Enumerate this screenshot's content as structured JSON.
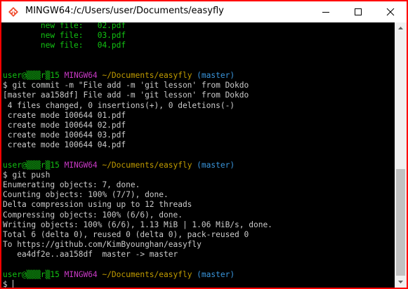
{
  "window": {
    "title": "MINGW64:/c/Users/user/Documents/easyfly",
    "icon": "mingw-icon"
  },
  "colors": {
    "green": "#13c313",
    "magenta": "#c839c5",
    "yellow": "#c19c00",
    "cyan": "#3a96dd",
    "text": "#cccccc"
  },
  "terminal": {
    "lines": [
      [
        {
          "t": "        new file:   02.pdf",
          "c": "green"
        }
      ],
      [
        {
          "t": "        new file:   03.pdf",
          "c": "green"
        }
      ],
      [
        {
          "t": "        new file:   04.pdf",
          "c": "green"
        }
      ],
      [
        {
          "t": "",
          "c": "text"
        }
      ],
      [
        {
          "t": "",
          "c": "text"
        }
      ],
      [
        {
          "t": "user@▒▒▒r▒15 ",
          "c": "green"
        },
        {
          "t": "MINGW64 ",
          "c": "magenta"
        },
        {
          "t": "~/Documents/easyfly",
          "c": "yellow"
        },
        {
          "t": " (master)",
          "c": "cyan"
        }
      ],
      [
        {
          "t": "$ git commit -m \"File add -m 'git lesson' from Dokdo",
          "c": "text"
        }
      ],
      [
        {
          "t": "[master aa158df] File add -m 'git lesson' from Dokdo",
          "c": "text"
        }
      ],
      [
        {
          "t": " 4 files changed, 0 insertions(+), 0 deletions(-)",
          "c": "text"
        }
      ],
      [
        {
          "t": " create mode 100644 01.pdf",
          "c": "text"
        }
      ],
      [
        {
          "t": " create mode 100644 02.pdf",
          "c": "text"
        }
      ],
      [
        {
          "t": " create mode 100644 03.pdf",
          "c": "text"
        }
      ],
      [
        {
          "t": " create mode 100644 04.pdf",
          "c": "text"
        }
      ],
      [
        {
          "t": "",
          "c": "text"
        }
      ],
      [
        {
          "t": "user@▒▒▒r▒15 ",
          "c": "green"
        },
        {
          "t": "MINGW64 ",
          "c": "magenta"
        },
        {
          "t": "~/Documents/easyfly",
          "c": "yellow"
        },
        {
          "t": " (master)",
          "c": "cyan"
        }
      ],
      [
        {
          "t": "$ git push",
          "c": "text"
        }
      ],
      [
        {
          "t": "Enumerating objects: 7, done.",
          "c": "text"
        }
      ],
      [
        {
          "t": "Counting objects: 100% (7/7), done.",
          "c": "text"
        }
      ],
      [
        {
          "t": "Delta compression using up to 12 threads",
          "c": "text"
        }
      ],
      [
        {
          "t": "Compressing objects: 100% (6/6), done.",
          "c": "text"
        }
      ],
      [
        {
          "t": "Writing objects: 100% (6/6), 1.13 MiB | 1.06 MiB/s, done.",
          "c": "text"
        }
      ],
      [
        {
          "t": "Total 6 (delta 0), reused 0 (delta 0), pack-reused 0",
          "c": "text"
        }
      ],
      [
        {
          "t": "To https://github.com/KimByounghan/easyfly",
          "c": "text"
        }
      ],
      [
        {
          "t": "   ea4df2e..aa158df  master -> master",
          "c": "text"
        }
      ],
      [
        {
          "t": "",
          "c": "text"
        }
      ],
      [
        {
          "t": "user@▒▒▒r▒15 ",
          "c": "green"
        },
        {
          "t": "MINGW64 ",
          "c": "magenta"
        },
        {
          "t": "~/Documents/easyfly",
          "c": "yellow"
        },
        {
          "t": " (master)",
          "c": "cyan"
        }
      ],
      [
        {
          "t": "$ ",
          "c": "text"
        }
      ]
    ]
  },
  "scrollbar": {
    "up_icon": "scroll-up-arrow-icon",
    "down_icon": "scroll-down-arrow-icon"
  }
}
